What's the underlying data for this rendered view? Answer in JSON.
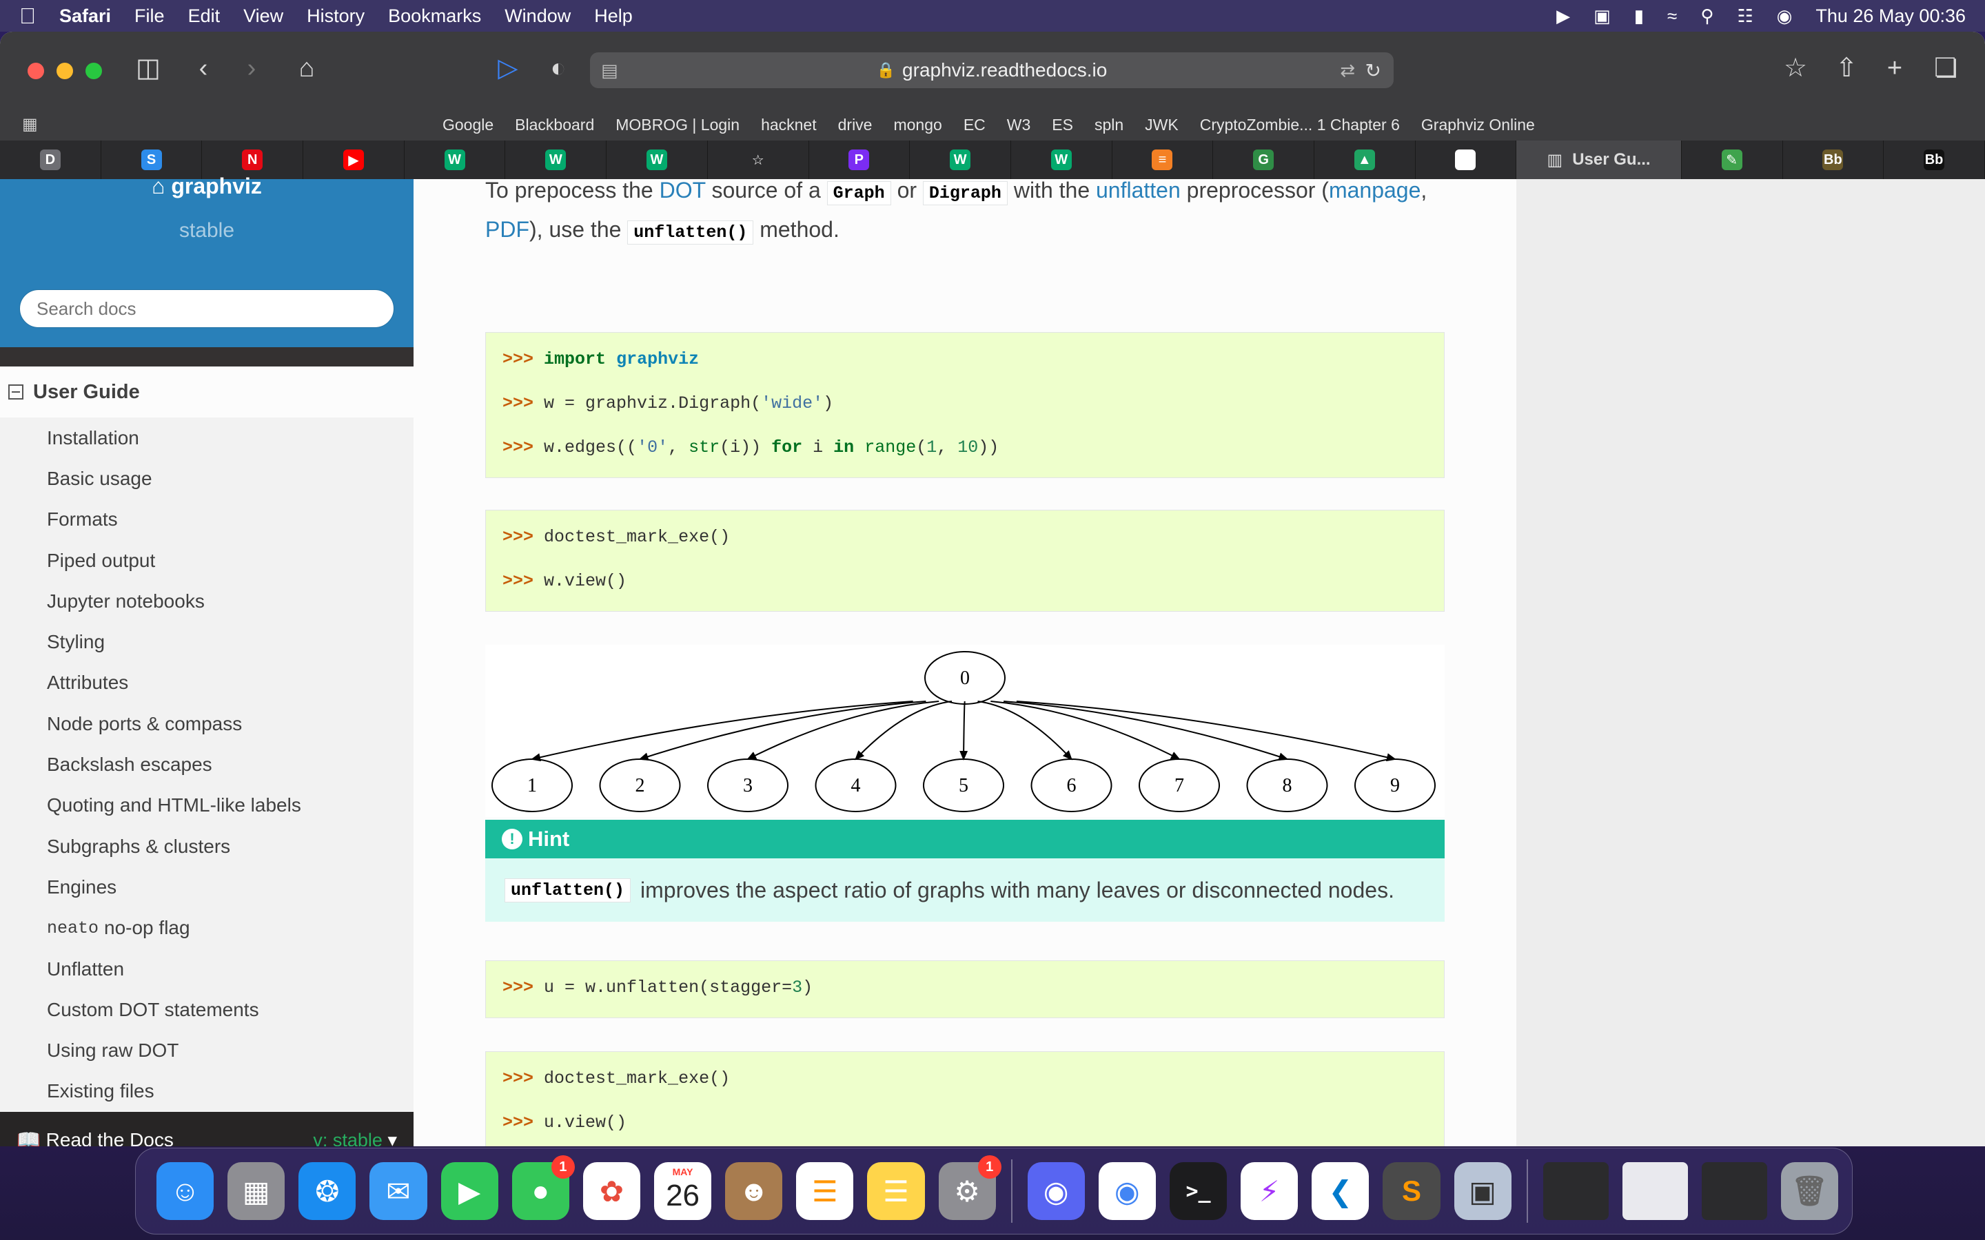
{
  "menubar": {
    "app": "Safari",
    "items": [
      "File",
      "Edit",
      "View",
      "History",
      "Bookmarks",
      "Window",
      "Help"
    ],
    "datetime": "Thu 26 May  00:36"
  },
  "toolbar": {
    "url": "graphviz.readthedocs.io"
  },
  "bookmarks": [
    "Google",
    "Blackboard",
    "MOBROG | Login",
    "hacknet",
    "drive",
    "mongo",
    "EC",
    "W3",
    "ES",
    "spln",
    "JWK",
    "CryptoZombie... 1 Chapter 6",
    "Graphviz Online"
  ],
  "tabs": [
    {
      "icon": "d-icon",
      "glyph": "D",
      "color": "#6e6e73"
    },
    {
      "icon": "s-icon",
      "glyph": "S",
      "color": "#2d8ceb"
    },
    {
      "icon": "netflix-icon",
      "glyph": "N",
      "color": "#e50914"
    },
    {
      "icon": "youtube-icon",
      "glyph": "▶",
      "color": "#ff0000"
    },
    {
      "icon": "w3-icon",
      "glyph": "W",
      "color": "#04aa6d"
    },
    {
      "icon": "w3-icon",
      "glyph": "W",
      "color": "#04aa6d"
    },
    {
      "icon": "w3-icon",
      "glyph": "W",
      "color": "#04aa6d"
    },
    {
      "icon": "star-icon",
      "glyph": "☆",
      "color": "transparent"
    },
    {
      "icon": "purple-p-icon",
      "glyph": "P",
      "color": "#7b2cf3"
    },
    {
      "icon": "w3-icon",
      "glyph": "W",
      "color": "#04aa6d"
    },
    {
      "icon": "w3-icon",
      "glyph": "W",
      "color": "#04aa6d"
    },
    {
      "icon": "stackoverflow-icon",
      "glyph": "≡",
      "color": "#f48024"
    },
    {
      "icon": "gfg-icon",
      "glyph": "G",
      "color": "#2f8d46"
    },
    {
      "icon": "drive-icon",
      "glyph": "▲",
      "color": "#1fa463"
    },
    {
      "icon": "github-icon",
      "glyph": "●",
      "color": "#ffffff"
    }
  ],
  "active_tab": {
    "label": "User Gu...",
    "icon": "docs-icon"
  },
  "tabs_after": [
    {
      "icon": "leaf-icon",
      "glyph": "✎",
      "color": "#3fa34d"
    },
    {
      "icon": "blackboard-icon",
      "glyph": "Bb",
      "color": "#6b5a2a"
    },
    {
      "icon": "blackboard-icon",
      "glyph": "Bb",
      "color": "#111111"
    }
  ],
  "sidebar": {
    "project": "graphviz",
    "version": "stable",
    "search_placeholder": "Search docs",
    "caption": "User Guide",
    "items": [
      {
        "label": "Installation"
      },
      {
        "label": "Basic usage"
      },
      {
        "label": "Formats"
      },
      {
        "label": "Piped output"
      },
      {
        "label": "Jupyter notebooks"
      },
      {
        "label": "Styling"
      },
      {
        "label": "Attributes"
      },
      {
        "label": "Node ports & compass"
      },
      {
        "label": "Backslash escapes"
      },
      {
        "label": "Quoting and HTML-like labels"
      },
      {
        "label": "Subgraphs & clusters"
      },
      {
        "label": "Engines"
      },
      {
        "label": "no-op flag",
        "code": "neato"
      },
      {
        "label": "Unflatten"
      },
      {
        "label": "Custom DOT statements"
      },
      {
        "label": "Using raw DOT"
      },
      {
        "label": "Existing files"
      }
    ],
    "rtd_label": "Read the Docs",
    "rtd_version": "v: stable"
  },
  "content": {
    "intro": {
      "t1": "To prepocess the ",
      "a1": "DOT",
      "t2": " source of a ",
      "c1": "Graph",
      "t3": " or ",
      "c2": "Digraph",
      "t4": " with the ",
      "a2": "unflatten",
      "t5": " preprocessor (",
      "a3": "manpage",
      "t6": ",",
      "a4": "PDF",
      "t7": "), use the ",
      "c3": "unflatten()",
      "t8": " method."
    },
    "code1": {
      "l1_kw": "import",
      "l1_mod": "graphviz",
      "l2_pre": "w = graphviz.Digraph(",
      "l2_str": "'wide'",
      "l2_post": ")",
      "l3_a": "w.edges((",
      "l3_s": "'0'",
      "l3_b": ", ",
      "l3_nb": "str",
      "l3_c": "(i)) ",
      "l3_for": "for",
      "l3_d": " i ",
      "l3_in": "in",
      "l3_e": " ",
      "l3_range": "range",
      "l3_f": "(",
      "l3_n1": "1",
      "l3_g": ", ",
      "l3_n2": "10",
      "l3_h": "))"
    },
    "prompt": ">>>",
    "code2": {
      "l1": "doctest_mark_exe()",
      "l2": "w.view()"
    },
    "graph": {
      "root": "0",
      "leaves": [
        "1",
        "2",
        "3",
        "4",
        "5",
        "6",
        "7",
        "8",
        "9"
      ]
    },
    "hint": {
      "title": "Hint",
      "code": "unflatten()",
      "text": "improves the aspect ratio of graphs with many leaves or disconnected nodes."
    },
    "code3": {
      "pre": "u = w.unflatten(stagger=",
      "num": "3",
      "post": ")"
    },
    "code4": {
      "l1": "doctest_mark_exe()",
      "l2": "u.view()"
    }
  },
  "dock": {
    "calendar_month": "MAY",
    "calendar_day": "26",
    "messages_badge": "1",
    "settings_badge": "1"
  }
}
